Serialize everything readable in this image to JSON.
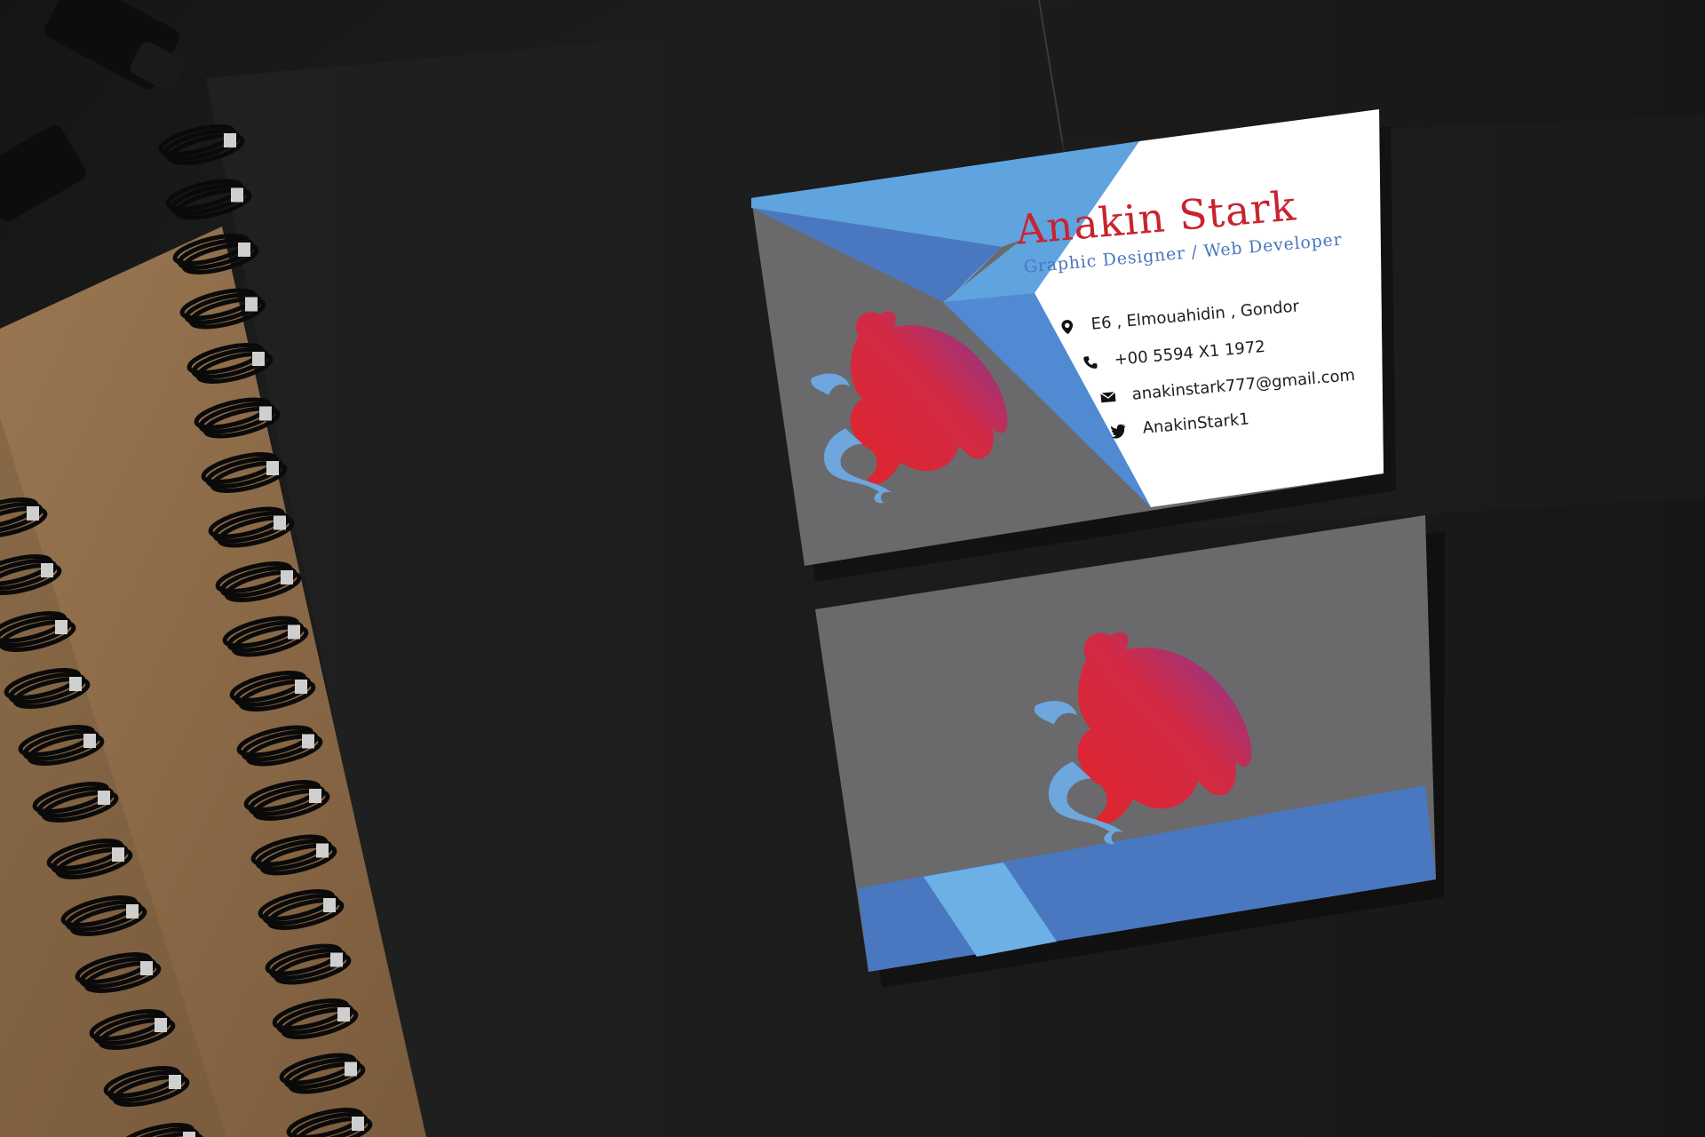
{
  "card_front": {
    "name": "Anakin Stark",
    "title": "Graphic Designer / Web Developer",
    "contacts": [
      {
        "icon": "location-pin-icon",
        "text": "E6 , Elmouahidin , Gondor"
      },
      {
        "icon": "phone-icon",
        "text": "+00 5594 X1 1972"
      },
      {
        "icon": "envelope-icon",
        "text": "anakinstark777@gmail.com"
      },
      {
        "icon": "twitter-bird-icon",
        "text": "AnakinStark1"
      }
    ]
  },
  "colors": {
    "background": "#1b1b1b",
    "card_gray": "#6a6a6c",
    "blue_light": "#5fa3df",
    "blue_dark": "#4a78c0",
    "name_red": "#c8242f",
    "kraft": "#8b6a48"
  }
}
